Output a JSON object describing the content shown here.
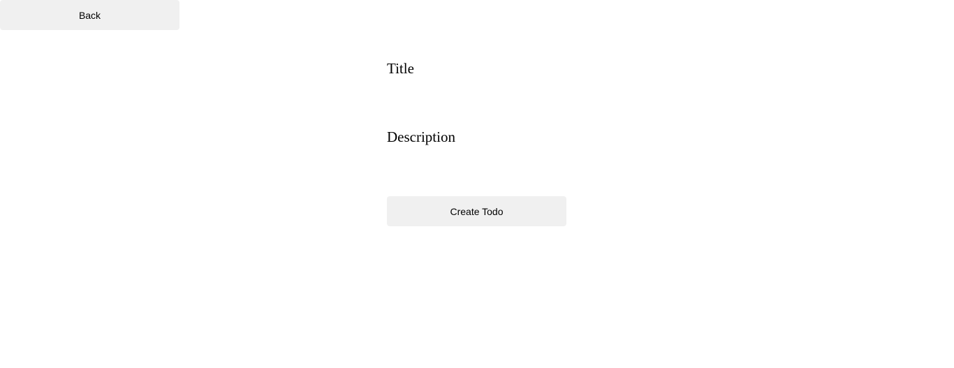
{
  "navigation": {
    "back_label": "Back"
  },
  "form": {
    "title_label": "Title",
    "title_value": "",
    "description_label": "Description",
    "description_value": "",
    "submit_label": "Create Todo"
  },
  "colors": {
    "button_background": "#f0f0f0",
    "page_background": "#ffffff",
    "text": "#000000"
  }
}
